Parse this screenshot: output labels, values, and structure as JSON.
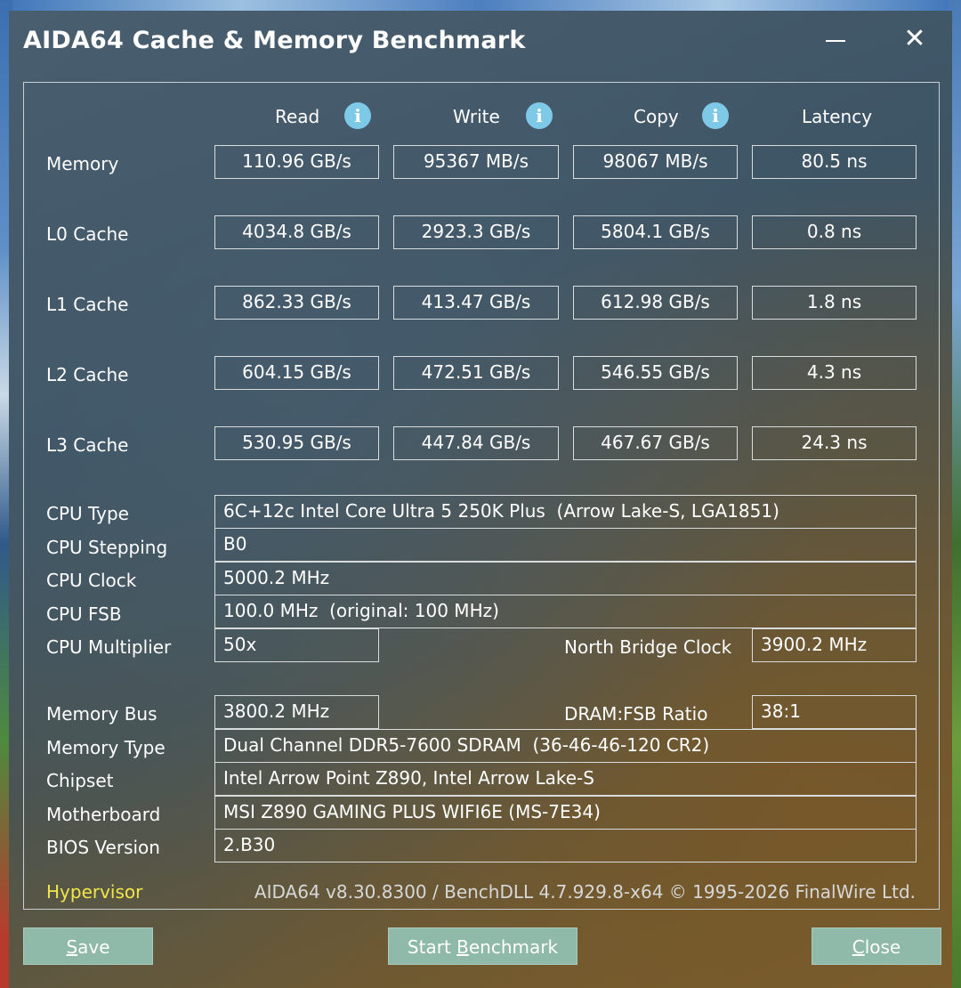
{
  "window": {
    "title": "AIDA64 Cache & Memory Benchmark",
    "close_glyph": "✕"
  },
  "columns": {
    "read": "Read",
    "write": "Write",
    "copy": "Copy",
    "latency": "Latency",
    "info_glyph": "i"
  },
  "bench_rows": [
    {
      "label": "Memory",
      "read": "110.96 GB/s",
      "write": "95367 MB/s",
      "copy": "98067 MB/s",
      "latency": "80.5 ns"
    },
    {
      "label": "L0 Cache",
      "read": "4034.8 GB/s",
      "write": "2923.3 GB/s",
      "copy": "5804.1 GB/s",
      "latency": "0.8 ns"
    },
    {
      "label": "L1 Cache",
      "read": "862.33 GB/s",
      "write": "413.47 GB/s",
      "copy": "612.98 GB/s",
      "latency": "1.8 ns"
    },
    {
      "label": "L2 Cache",
      "read": "604.15 GB/s",
      "write": "472.51 GB/s",
      "copy": "546.55 GB/s",
      "latency": "4.3 ns"
    },
    {
      "label": "L3 Cache",
      "read": "530.95 GB/s",
      "write": "447.84 GB/s",
      "copy": "467.67 GB/s",
      "latency": "24.3 ns"
    }
  ],
  "cpu": {
    "type_label": "CPU Type",
    "type_value": "6C+12c Intel Core Ultra 5 250K Plus  (Arrow Lake-S, LGA1851)",
    "stepping_label": "CPU Stepping",
    "stepping_value": "B0",
    "clock_label": "CPU Clock",
    "clock_value": "5000.2 MHz",
    "fsb_label": "CPU FSB",
    "fsb_value": "100.0 MHz  (original: 100 MHz)",
    "multiplier_label": "CPU Multiplier",
    "multiplier_value": "50x",
    "nb_clock_label": "North Bridge Clock",
    "nb_clock_value": "3900.2 MHz"
  },
  "memory": {
    "bus_label": "Memory Bus",
    "bus_value": "3800.2 MHz",
    "ratio_label": "DRAM:FSB Ratio",
    "ratio_value": "38:1",
    "type_label": "Memory Type",
    "type_value": "Dual Channel DDR5-7600 SDRAM  (36-46-46-120 CR2)",
    "chipset_label": "Chipset",
    "chipset_value": "Intel Arrow Point Z890, Intel Arrow Lake-S",
    "motherboard_label": "Motherboard",
    "motherboard_value": "MSI Z890 GAMING PLUS WIFI6E (MS-7E34)",
    "bios_label": "BIOS Version",
    "bios_value": "2.B30"
  },
  "footer": {
    "hypervisor": "Hypervisor",
    "version_info": "AIDA64 v8.30.8300 / BenchDLL 4.7.929.8-x64 © 1995-2026 FinalWire Ltd."
  },
  "buttons": {
    "save_u": "S",
    "save_rest": "ave",
    "start_pre": "Start ",
    "start_u": "B",
    "start_rest": "enchmark",
    "close_u": "C",
    "close_rest": "lose"
  }
}
